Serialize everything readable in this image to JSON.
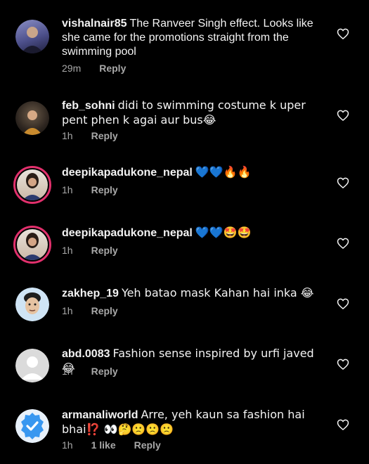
{
  "comments": [
    {
      "username": "vishalnair85",
      "text": "The Ranveer Singh effect. Looks like she came for the promotions straight from the swimming pool",
      "time": "29m",
      "likes": "",
      "reply": "Reply",
      "avatar": "person-photo-icon"
    },
    {
      "username": "feb_sohni",
      "text": "didi to swimming costume k uper pent phen k agai aur bus😂",
      "time": "1h",
      "likes": "",
      "reply": "Reply",
      "avatar": "person-photo-icon"
    },
    {
      "username": "deepikapadukone_nepal",
      "text": "💙💙🔥🔥",
      "time": "1h",
      "likes": "",
      "reply": "Reply",
      "avatar": "story-ring-photo-icon"
    },
    {
      "username": "deepikapadukone_nepal",
      "text": "💙💙🤩🤩",
      "time": "1h",
      "likes": "",
      "reply": "Reply",
      "avatar": "story-ring-photo-icon"
    },
    {
      "username": "zakhep_19",
      "text": "Yeh batao mask Kahan hai inka 😂",
      "time": "1h",
      "likes": "",
      "reply": "Reply",
      "avatar": "cartoon-face-icon"
    },
    {
      "username": "abd.0083",
      "text": "Fashion sense inspired by urfi javed😂",
      "time": "1h",
      "likes": "",
      "reply": "Reply",
      "avatar": "default-avatar-icon"
    },
    {
      "username": "armanaliworld",
      "text": "Arre, yeh kaun sa fashion hai bhai⁉️ 👀🤔🙁🙁🙁",
      "time": "1h",
      "likes": "1 like",
      "reply": "Reply",
      "avatar": "verified-badge-icon"
    }
  ],
  "colors": {
    "background": "#000000",
    "text": "#f3f3f3",
    "muted": "#a8a8a8",
    "story_ring": "#e1306c"
  }
}
